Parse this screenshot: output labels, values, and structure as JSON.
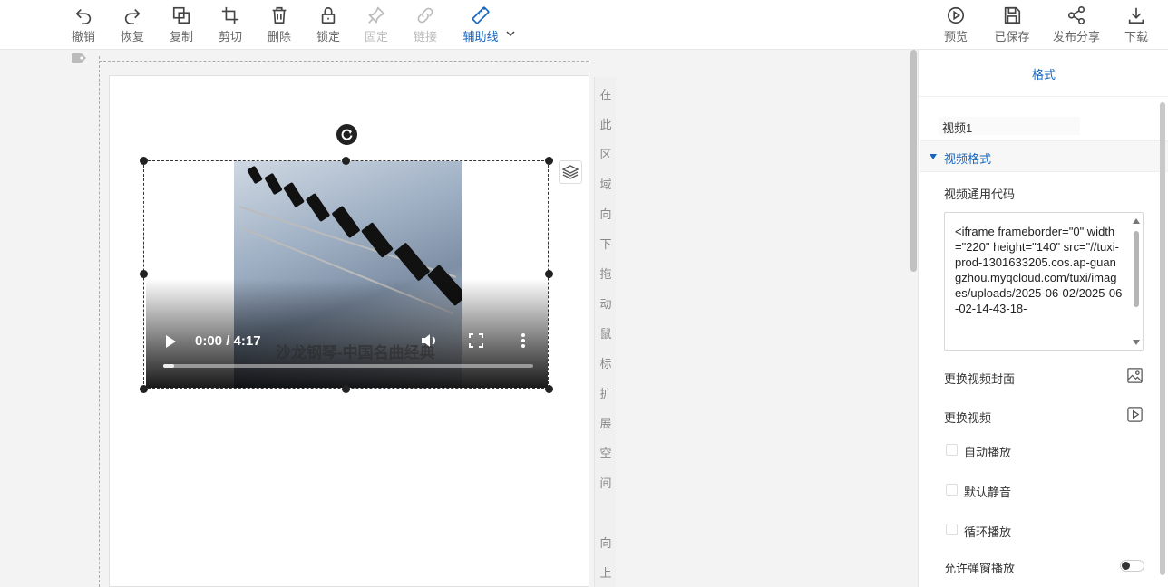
{
  "toolbar": {
    "undo": "撤销",
    "redo": "恢复",
    "copy": "复制",
    "crop": "剪切",
    "delete": "删除",
    "lock": "锁定",
    "pin": "固定",
    "link": "链接",
    "guides": "辅助线",
    "preview": "预览",
    "saved": "已保存",
    "publish_share": "发布分享",
    "download": "下载",
    "accent_color": "#1565c0"
  },
  "canvas": {
    "hint_chars": [
      "在",
      "此",
      "区",
      "域",
      "向",
      "下",
      "拖",
      "动",
      "鼠",
      "标",
      "扩",
      "展",
      "空",
      "间",
      "向",
      "上"
    ]
  },
  "video": {
    "time": "0:00 / 4:17",
    "watermark": "沙龙钢琴-中国名曲经典",
    "progress_fraction": 0.0
  },
  "panel": {
    "tab_format": "格式",
    "element_name": "视频1",
    "section_title": "视频格式",
    "embed_code_label": "视频通用代码",
    "embed_code": "<iframe frameborder=\"0\" width=\"220\" height=\"140\" src=\"//tuxi-prod-1301633205.cos.ap-guangzhou.myqcloud.com/tuxi/images/uploads/2025-06-02/2025-06-02-14-43-18-",
    "change_cover": "更换视频封面",
    "change_video": "更换视频",
    "autoplay": "自动播放",
    "muted": "默认静音",
    "loop": "循环播放",
    "allow_popup": "允许弹窗播放"
  }
}
